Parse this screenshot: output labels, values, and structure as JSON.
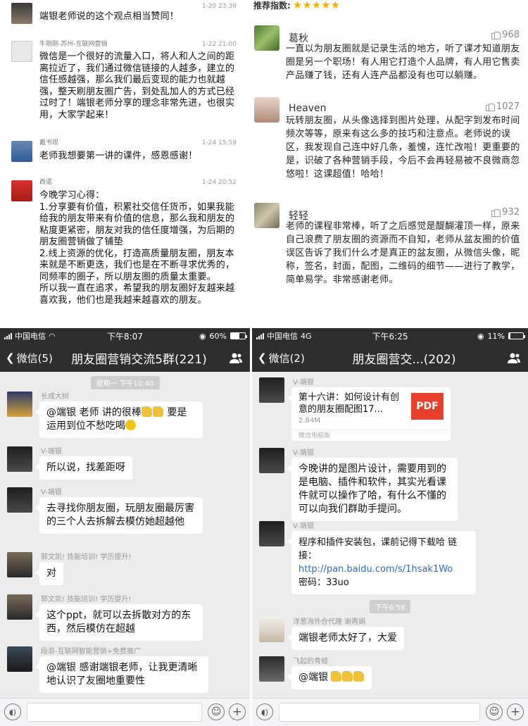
{
  "top_left": {
    "messages": [
      {
        "name": "",
        "time": "1-20 23:30",
        "text": "端银老师说的这个观点相当赞同！"
      },
      {
        "name": "牛刚刚-苏州-互联网营销",
        "time": "1-22 21:00",
        "text": "微信是一个很好的流量入口，将人和人之间的距离拉近了，我们通过微信链接的人越多，建立的信任感越强，那么我们最后变现的能力也就越强，整天刷朋友圈广告，到处乱加人的方式已经过时了！端银老师分享的理念非常先进，也很实用，大家学起来！"
      },
      {
        "name": "戴书现",
        "time": "1-24 15:59",
        "text": "老师我想要第一讲的课件，感恩感谢！"
      },
      {
        "name": "西诺",
        "time": "1-24 20:52",
        "lines": [
          "今晚学习心得：",
          "1.分享要有价值，积累社交信任货币，如果我能给我的朋友带来有价值的信息，那么我和朋友的粘度更紧密，朋友对我的信任度增强，为后期的朋友圈营销做了铺垫",
          "2.线上资源的优化，打造高质量朋友圈，朋友本来就是不断更迭，我们也是在不断寻求优秀的，同频率的圈子，所以朋友圈的质量太重要。",
          "所以我一直在追求，希望我的朋友圈好友越来越喜欢我，他们也是我越来越喜欢的朋友。"
        ]
      }
    ]
  },
  "top_right": {
    "rating_label": "推荐指数:",
    "stars": "★★★★★",
    "reviews": [
      {
        "name": "葛秋",
        "likes": "968",
        "text": "一直以为朋友圈就是记录生活的地方，听了课才知道朋友圈是另一个职场！有人用它打造个人品牌，有人用它售卖产品赚了钱，还有人连产品都没有也可以躺赚。"
      },
      {
        "name": "Heaven",
        "likes": "1027",
        "text": "玩转朋友圈，从头像选择到图片处理，从配字到发布时间频次等等，原来有这么多的技巧和注意点。老师说的误区，我发现自己连中好几条，羞愧，连忙改啦！更重要的是，识破了各种营销手段，今后不会再轻易被不良微商忽悠啦！这课超值！哈哈！"
      },
      {
        "name": "轻轻",
        "likes": "932",
        "text": "老师的课程非常棒，听了之后感觉是醍醐灌顶一样，原来自己浪费了朋友圈的资源而不自知，老师从盆友圈的价值误区告诉了我们什么才是真正的盆友圈，从微信头像，昵称，签名，封面，配图，二维码的细节——进行了教学，简单易学。非常感谢老师。"
      }
    ]
  },
  "bottom_left": {
    "status": {
      "carrier": "中国电信",
      "time": "下午8:07",
      "battery": "60%",
      "battery_level": 0.6
    },
    "nav": {
      "back": "微信(5)",
      "title": "朋友圈营销交流5群(221)"
    },
    "timestamp": "星期一 下午10:40",
    "messages": [
      {
        "name": "长成大树",
        "text_a": "@端银 老师  讲的很棒",
        "text_b": " 要是运用到位不愁吃喝"
      },
      {
        "name": "V-端银",
        "text": "所以说，找差距呀"
      },
      {
        "name": "V-端银",
        "text": "去寻找你朋友圈，玩朋友圈最厉害的三个人去拆解去模仿她超越他"
      },
      {
        "name": "郭文凯! 技能培训! 学历提升!",
        "text": "对"
      },
      {
        "name": "郭文凯! 技能培训! 学历提升!",
        "text": "这个ppt，就可以去拆散对方的东西，然后模仿在超越"
      },
      {
        "name": "段浪-互联网智能营销+免费推广",
        "text": "@端银 感谢端银老师，让我更清晰地认识了友圈地重要性"
      }
    ]
  },
  "bottom_right": {
    "status": {
      "carrier": "中国电信",
      "network": "4G",
      "time": "下午6:25",
      "battery": "11%",
      "battery_level": 0.11
    },
    "nav": {
      "back": "微信(2)",
      "title": "朋友圈营交...(202)"
    },
    "file": {
      "name": "V-端银",
      "title": "第十六讲：如何设计有创意的朋友圈配图17...",
      "size": "2.84M",
      "type": "PDF",
      "source": "微信电脑版"
    },
    "messages": [
      {
        "name": "V-端银",
        "text": "今晚讲的是图片设计，需要用到的是电脑、插件和软件，其实光看课件就可以操作了哈，有什么不懂的可以向我们群助手提问。"
      },
      {
        "name": "V-端银",
        "text_a": "程序和插件安装包，课前记得下载哈  链接：",
        "link": "http://pan.baidu.com/s/1hsak1Wo",
        "text_b": "密码：33uo"
      }
    ],
    "timestamp": "下午6:58",
    "messages2": [
      {
        "name": "洋葱海外仓代理 谢再娟",
        "text": "端银老师太好了，大爱"
      },
      {
        "name": "飞起的青蛙",
        "text": "@端银 "
      }
    ]
  },
  "colors": {
    "nav_bg": "#2e2e2e",
    "chat_bg": "#ececec",
    "star": "#f3b300",
    "pdf": "#e8402c",
    "link": "#2a6bbf"
  }
}
